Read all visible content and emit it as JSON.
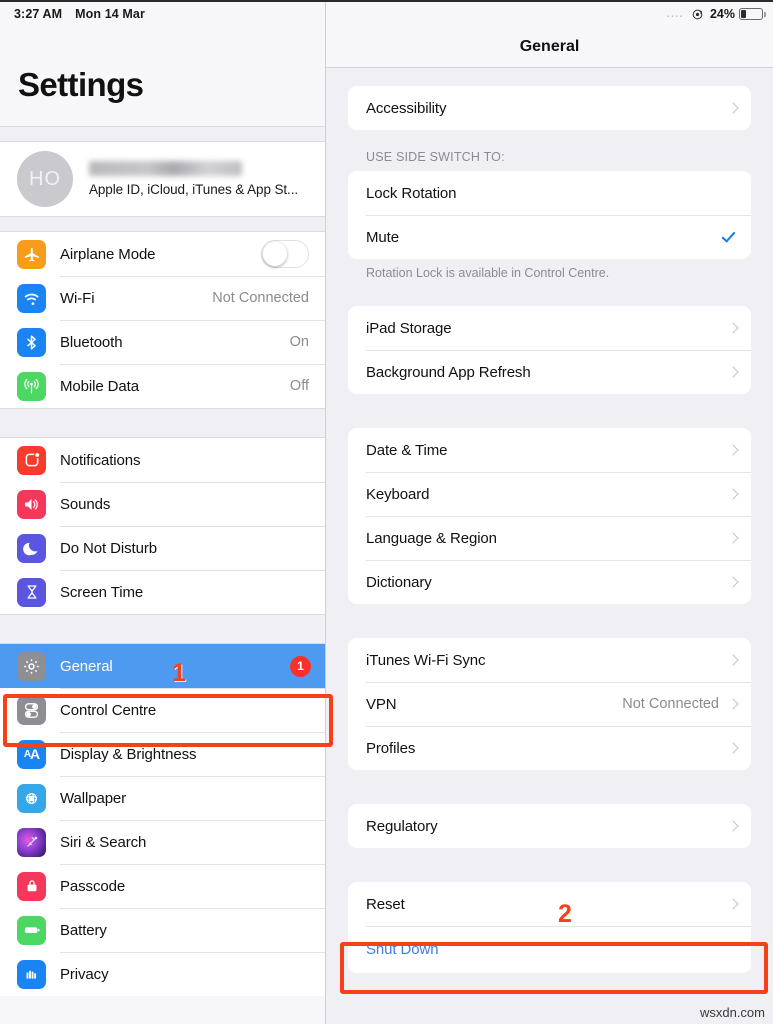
{
  "status_bar": {
    "time": "3:27 AM",
    "date": "Mon 14 Mar",
    "battery_percent": "24%",
    "battery_level": 24,
    "rotation_lock_icon": "rotation-lock-icon",
    "signal_dots": "...."
  },
  "sidebar": {
    "title": "Settings",
    "account": {
      "avatar_initials": "HO",
      "name_redacted": true,
      "subtitle": "Apple ID, iCloud, iTunes & App St..."
    },
    "groups": [
      {
        "id": "connectivity",
        "items": [
          {
            "label": "Airplane Mode",
            "icon": "airplane-icon",
            "icon_color": "#f79c1b",
            "control": "toggle",
            "toggle_on": false
          },
          {
            "label": "Wi-Fi",
            "icon": "wifi-icon",
            "icon_color": "#1b84f3",
            "value": "Not Connected"
          },
          {
            "label": "Bluetooth",
            "icon": "bluetooth-icon",
            "icon_color": "#1b84f3",
            "value": "On"
          },
          {
            "label": "Mobile Data",
            "icon": "mobile-data-icon",
            "icon_color": "#4cd662",
            "value": "Off"
          }
        ]
      },
      {
        "id": "notifications",
        "items": [
          {
            "label": "Notifications",
            "icon": "notifications-icon",
            "icon_color": "#f73c2e"
          },
          {
            "label": "Sounds",
            "icon": "sounds-icon",
            "icon_color": "#f5375b"
          },
          {
            "label": "Do Not Disturb",
            "icon": "do-not-disturb-icon",
            "icon_color": "#5a56e0"
          },
          {
            "label": "Screen Time",
            "icon": "screen-time-icon",
            "icon_color": "#5a56e0"
          }
        ]
      },
      {
        "id": "system",
        "items": [
          {
            "label": "General",
            "icon": "gear-icon",
            "icon_color": "#8e8e93",
            "selected": true,
            "badge": "1"
          },
          {
            "label": "Control Centre",
            "icon": "control-centre-icon",
            "icon_color": "#8e8e93"
          },
          {
            "label": "Display & Brightness",
            "icon": "display-brightness-icon",
            "icon_color": "#1b84f3"
          },
          {
            "label": "Wallpaper",
            "icon": "wallpaper-icon",
            "icon_color": "#35a7e8"
          },
          {
            "label": "Siri & Search",
            "icon": "siri-icon",
            "icon_color": "#2c1a4a"
          },
          {
            "label": "Passcode",
            "icon": "passcode-lock-icon",
            "icon_color": "#f5375b"
          },
          {
            "label": "Battery",
            "icon": "battery-icon",
            "icon_color": "#4cd662"
          },
          {
            "label": "Privacy",
            "icon": "privacy-hand-icon",
            "icon_color": "#1b84f3"
          }
        ]
      }
    ]
  },
  "main": {
    "header_title": "General",
    "sections": [
      {
        "id": "accessibility",
        "header": "",
        "footer": "",
        "rows": [
          {
            "label": "Accessibility",
            "accessory": "chevron"
          }
        ]
      },
      {
        "id": "side-switch",
        "header": "USE SIDE SWITCH TO:",
        "footer": "Rotation Lock is available in Control Centre.",
        "rows": [
          {
            "label": "Lock Rotation",
            "accessory": "none"
          },
          {
            "label": "Mute",
            "accessory": "check"
          }
        ]
      },
      {
        "id": "storage",
        "header": "",
        "footer": "",
        "rows": [
          {
            "label": "iPad Storage",
            "accessory": "chevron"
          },
          {
            "label": "Background App Refresh",
            "accessory": "chevron"
          }
        ]
      },
      {
        "id": "locale",
        "header": "",
        "footer": "",
        "rows": [
          {
            "label": "Date & Time",
            "accessory": "chevron"
          },
          {
            "label": "Keyboard",
            "accessory": "chevron"
          },
          {
            "label": "Language & Region",
            "accessory": "chevron"
          },
          {
            "label": "Dictionary",
            "accessory": "chevron"
          }
        ]
      },
      {
        "id": "sync-vpn",
        "header": "",
        "footer": "",
        "rows": [
          {
            "label": "iTunes Wi-Fi Sync",
            "accessory": "chevron"
          },
          {
            "label": "VPN",
            "value": "Not Connected",
            "accessory": "chevron"
          },
          {
            "label": "Profiles",
            "accessory": "chevron"
          }
        ]
      },
      {
        "id": "regulatory",
        "header": "",
        "footer": "",
        "rows": [
          {
            "label": "Regulatory",
            "accessory": "chevron"
          }
        ]
      },
      {
        "id": "reset-shutdown",
        "header": "",
        "footer": "",
        "rows": [
          {
            "label": "Reset",
            "accessory": "chevron"
          },
          {
            "label": "Shut Down",
            "accessory": "none",
            "style": "link"
          }
        ]
      }
    ]
  },
  "annotations": {
    "step_one": "1",
    "step_two": "2",
    "accent_color": "#f6401a"
  },
  "watermark": "wsxdn.com"
}
